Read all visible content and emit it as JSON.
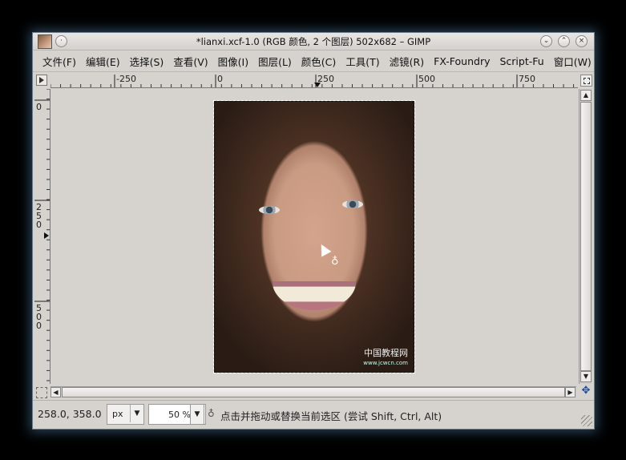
{
  "window": {
    "title": "*lianxi.xcf-1.0 (RGB 颜色, 2 个图层) 502x682 – GIMP"
  },
  "menu": {
    "items": [
      "文件(F)",
      "编辑(E)",
      "选择(S)",
      "查看(V)",
      "图像(I)",
      "图层(L)",
      "颜色(C)",
      "工具(T)",
      "滤镜(R)",
      "FX-Foundry",
      "Script-Fu",
      "窗口(W)"
    ]
  },
  "rulers": {
    "horizontal_labels": [
      "-250",
      "0",
      "250",
      "500",
      "750"
    ],
    "vertical_labels": [
      "0",
      "250",
      "500"
    ]
  },
  "image": {
    "watermark_main": "中国教程网",
    "watermark_sub": "www.jcwcn.com"
  },
  "status": {
    "coordinates": "258.0, 358.0",
    "unit": "px",
    "zoom": "50 %",
    "message": "点击并拖动或替换当前选区 (尝试 Shift, Ctrl, Alt)"
  },
  "icons": {
    "window_menu": "app-thumbnail-icon",
    "shade": "shade-icon",
    "minimize": "minimize-icon",
    "maximize": "maximize-icon",
    "close": "close-icon",
    "lasso": "lasso-select-icon",
    "navigate": "navigate-icon"
  },
  "colors": {
    "window_bg": "#d6d3cf",
    "desktop_bg": "#000000",
    "window_glow": "#5a96c8"
  }
}
